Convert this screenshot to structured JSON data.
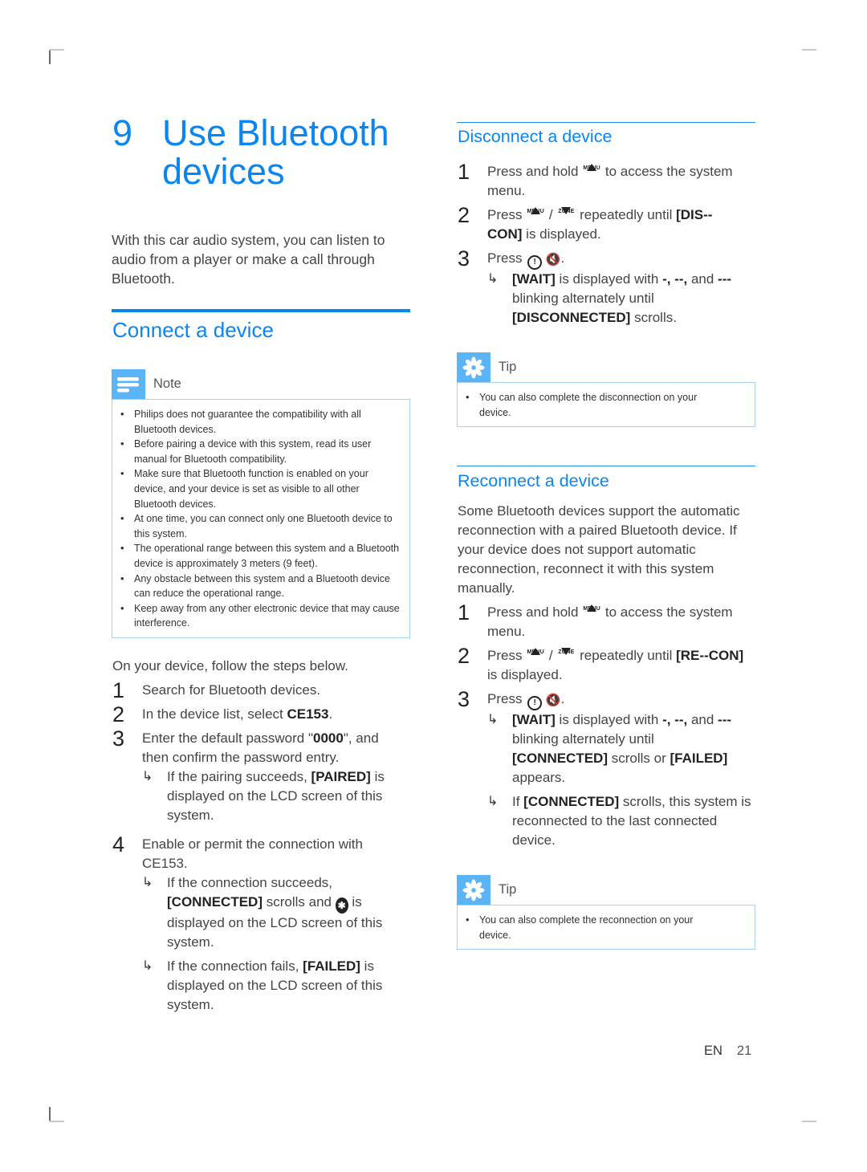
{
  "chapter": {
    "number": "9",
    "title": "Use Bluetooth devices",
    "intro": "With this car audio system, you can listen to audio from a player or make a call through Bluetooth."
  },
  "connect": {
    "title": "Connect a device",
    "note": {
      "label": "Note",
      "icon": "note-icon",
      "items": [
        "Philips does not guarantee the compatibility with all Bluetooth devices.",
        "Before pairing a device with this system, read its user manual for Bluetooth compatibility.",
        "Make sure that Bluetooth function is enabled on your device, and your device is set as visible to all other Bluetooth devices.",
        "At one time, you can connect only one Bluetooth device to this system.",
        "The operational range between this system and a Bluetooth device is approximately 3 meters (9 feet).",
        "Any obstacle between this system and a Bluetooth device can reduce the operational range.",
        "Keep away from any other electronic device that may cause interference."
      ]
    },
    "lead": "On your device, follow the steps below.",
    "steps": [
      {
        "n": "1",
        "text": "Search for Bluetooth devices."
      },
      {
        "n": "2",
        "pre": "In the device list, select ",
        "bold": "CE153",
        "post": "."
      },
      {
        "n": "3",
        "pre": "Enter the default password \"",
        "bold": "0000",
        "post": "\", and then confirm the password entry."
      },
      {
        "n": "4",
        "text": "Enable or permit the connection with CE153."
      }
    ],
    "step3_result": {
      "pre": "If the pairing succeeds, ",
      "bold": "[PAIRED]",
      "post": " is displayed on the LCD screen of this system."
    },
    "step4_results": [
      {
        "pre": "If the connection succeeds, ",
        "bold": "[CONNECTED]",
        "mid": " scrolls and ",
        "post": " is displayed on the LCD screen of this system."
      },
      {
        "pre": "If the connection fails, ",
        "bold": "[FAILED]",
        "post": " is displayed on the LCD screen of this system."
      }
    ]
  },
  "disconnect": {
    "title": "Disconnect a device",
    "step1": {
      "n": "1",
      "pre": "Press and hold ",
      "post": " to access the system menu."
    },
    "step2": {
      "n": "2",
      "pre": "Press ",
      "sep": " / ",
      "mid": " repeatedly until ",
      "bold": "[DIS--CON]",
      "post": " is displayed."
    },
    "step3": {
      "n": "3",
      "pre": "Press ",
      "post": "."
    },
    "result": {
      "bold1": "[WAIT]",
      "t1": " is displayed with ",
      "bold2": "-,  --,",
      "t2": " and ",
      "bold3": "---",
      "t3": " blinking alternately until ",
      "bold4": "[DISCONNECTED]",
      "t4": " scrolls."
    },
    "tip": {
      "label": "Tip",
      "icon": "tip-icon",
      "items": [
        "You can also complete the disconnection on your device."
      ]
    }
  },
  "reconnect": {
    "title": "Reconnect a device",
    "intro": "Some Bluetooth devices support the automatic reconnection with a paired Bluetooth device. If your device does not support automatic reconnection, reconnect it with this system manually.",
    "step1": {
      "n": "1",
      "pre": "Press and hold ",
      "post": " to access the system menu."
    },
    "step2": {
      "n": "2",
      "pre": "Press ",
      "sep": " / ",
      "mid": " repeatedly until ",
      "bold": "[RE--CON]",
      "post": " is displayed."
    },
    "step3": {
      "n": "3",
      "pre": "Press ",
      "post": "."
    },
    "result1": {
      "bold1": "[WAIT]",
      "t1": " is displayed with ",
      "bold2": "-,  --,",
      "t2": " and ",
      "bold3": "---",
      "t3": " blinking alternately until ",
      "bold4": "[CONNECTED]",
      "t4": " scrolls or ",
      "bold5": "[FAILED]",
      "t5": " appears."
    },
    "result2": {
      "pre": "If ",
      "bold": "[CONNECTED]",
      "post": " scrolls, this system is reconnected to the last connected device."
    },
    "tip": {
      "label": "Tip",
      "icon": "tip-icon",
      "items": [
        "You can also complete the reconnection on your device."
      ]
    }
  },
  "keys": {
    "menu": "MENU",
    "zone": "ZONE",
    "power_glyph": "!",
    "mute_glyph": "🔇",
    "bt_glyph": "B"
  },
  "footer": {
    "lang": "EN",
    "page": "21"
  },
  "colors": {
    "accent": "#0a86f0",
    "box_icon": "#5ab4f5",
    "box_border": "#a9d3f5"
  }
}
